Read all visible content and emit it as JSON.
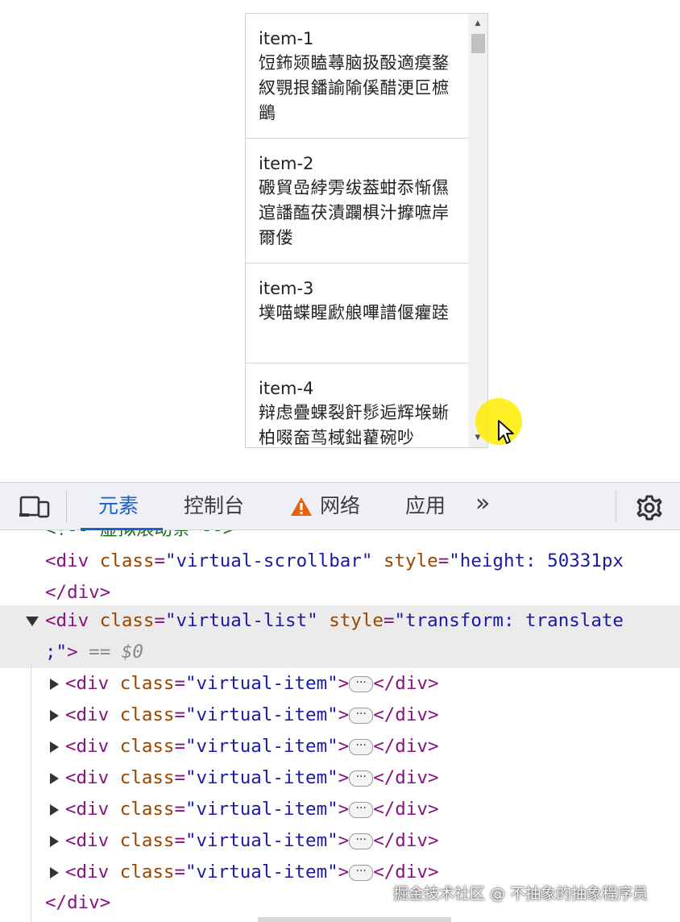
{
  "virtual_list": {
    "items": [
      {
        "title": "item-1",
        "text": "饾鈽颎瞌蕁脑扱酘適瘼鍪紁覨拫鐇諭隃傒醋浭叵樜鶅"
      },
      {
        "title": "item-2",
        "text": "磤貿嵒綍雱绂葢蚶忝惭儑逭譒醢茯漬躝椇汁擵嗻岸爾偻"
      },
      {
        "title": "item-3",
        "text": "墣喵蝶睲歋艆嗶譜偃癯踛"
      },
      {
        "title": "item-4",
        "text": "辩虑疊蜾裂飦髿逅辉堠蜥柏啜奤茑棫鈯藋碗吵"
      }
    ]
  },
  "devtools": {
    "tabs": [
      {
        "label": "元素",
        "active": true
      },
      {
        "label": "控制台"
      },
      {
        "label": "网络",
        "icon": "warning-icon"
      },
      {
        "label": "应用"
      }
    ],
    "more_label": "»",
    "lines": {
      "comment": "<!-- 虚拟滚动条 -->",
      "l1_tag_open": "<div ",
      "l1_attr_class": "class",
      "l1_val_class": "\"virtual-scrollbar\"",
      "l1_attr_style": "style",
      "l1_val_style": "\"height: 50331px",
      "l2_close": "</div>",
      "l3_tag_open": "<div ",
      "l3_attr_class": "class",
      "l3_val_class": "\"virtual-list\"",
      "l3_attr_style": "style",
      "l3_val_style": "\"transform: translate",
      "l4_val": ";\"",
      "l4_gt": ">",
      "l4_eq": " == $0",
      "child_tag": "<div ",
      "child_attr": "class",
      "child_val": "\"virtual-item\"",
      "child_gt": ">",
      "child_ellipsis": "···",
      "child_close": "</div>",
      "end_close": "</div>"
    },
    "child_count": 7
  },
  "watermark": "掘金技术社区 @ 不抽象的抽象程序员"
}
